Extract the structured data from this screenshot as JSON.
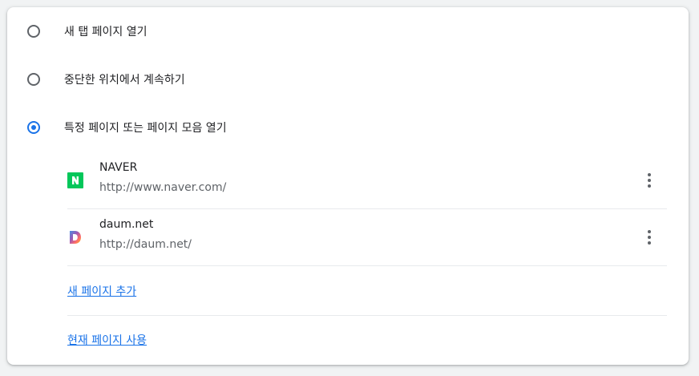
{
  "startup": {
    "options": [
      {
        "label": "새 탭 페이지 열기",
        "checked": false
      },
      {
        "label": "중단한 위치에서 계속하기",
        "checked": false
      },
      {
        "label": "특정 페이지 또는 페이지 모음 열기",
        "checked": true
      }
    ],
    "pages": [
      {
        "name": "NAVER",
        "url": "http://www.naver.com/",
        "icon": "naver-favicon"
      },
      {
        "name": "daum.net",
        "url": "http://daum.net/",
        "icon": "daum-favicon"
      }
    ],
    "add_page_label": "새 페이지 추가",
    "use_current_label": "현재 페이지 사용"
  },
  "colors": {
    "accent": "#1a73e8",
    "naver_green": "#03c75a"
  }
}
